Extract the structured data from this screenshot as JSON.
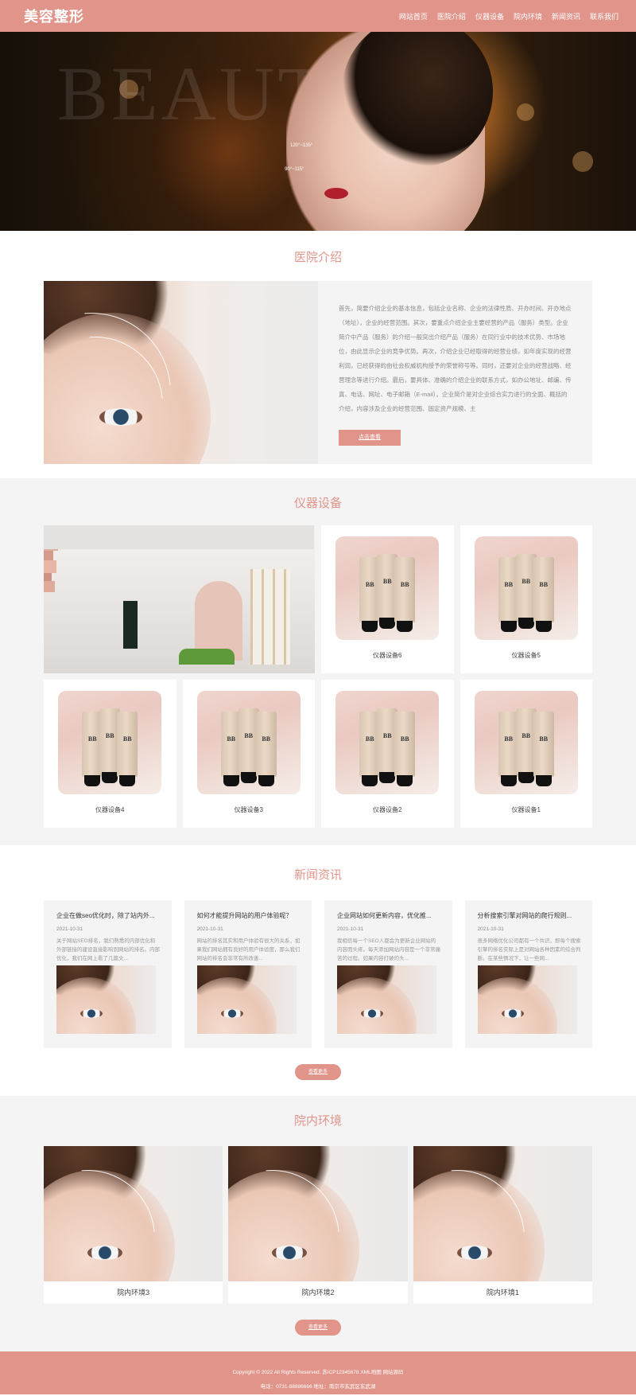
{
  "colors": {
    "accent": "#e0948a",
    "section_gray": "#f4f4f4"
  },
  "header": {
    "logo": "美容整形",
    "nav": [
      "网站首页",
      "医院介绍",
      "仪器设备",
      "院内环境",
      "新闻资讯",
      "联系我们"
    ]
  },
  "hero": {
    "word": "BEAUTY",
    "angle_top": "120°~135°",
    "angle_bottom": "90°~115°"
  },
  "intro": {
    "title": "医院介绍",
    "text": "首先，简要介绍企业的基本信息，包括企业名称、企业的法律性质、开办时间、开办地点（地址），企业的经营范围。其次，要重点介绍企业主要经营的产品（服务）类型。企业简介中产品（服务）的介绍一般突出介绍产品（服务）在同行业中的技术优势、市场地位，由此显示企业的竞争优势。再次，介绍企业已经取得的经营业绩，如年度实现的经营利润，已经获得的由社会权威机构授予的荣誉称号等。同时，还要对企业的经营战略、经营理念等进行介绍。最后，要具体、准确的介绍企业的联系方式，如办公地址、邮编、传真、电话、网址、电子邮箱（E-mail）。企业简介是对企业综合实力进行的全面、概括的介绍，内容涉及企业的经营范围、固定资产规模、主",
    "button": "点击查看"
  },
  "equipment": {
    "title": "仪器设备",
    "items": [
      "仪器设备6",
      "仪器设备5",
      "仪器设备4",
      "仪器设备3",
      "仪器设备2",
      "仪器设备1"
    ],
    "product_mark": "BB"
  },
  "news": {
    "title": "新闻资讯",
    "items": [
      {
        "title": "企业在做seo优化时，除了站内外...",
        "date": "2021-10-31",
        "desc": "关于网站SEO排名，我们熟悉的内部优化和外部链接的建设直接影响到网站的排名。内部优化，我们在网上看了几篇文..."
      },
      {
        "title": "如何才能提升网站的用户体验呢？",
        "date": "2021-10-31",
        "desc": "网站的排名其实和用户体验有很大的关系，如果我们网站拥有良好的用户体验度，那么我们网站的排名会非常有所改善..."
      },
      {
        "title": "企业网站如何更新内容，优化推...",
        "date": "2021-10-31",
        "desc": "我相信每一个SEO人都会为更新企业网站的内容而头疼。每天添加网站内容是一个非常痛苦的过程。如果内容打破的头..."
      },
      {
        "title": "分析搜索引擎对网站的爬行规则...",
        "date": "2021-10-31",
        "desc": "很多网络优化公司都有一个共识，即每个搜索引擎的排名实际上是对网站各种因素的综合判断。在某些情况下，让一些网..."
      }
    ],
    "more": "查看更多"
  },
  "environment": {
    "title": "院内环境",
    "items": [
      "院内环境3",
      "院内环境2",
      "院内环境1"
    ],
    "more": "查看更多"
  },
  "footer": {
    "line1": "Copyright © 2022 All Rights Reserved. 苏ICP12345678 XML地图 网站源码",
    "line2": "电话：0731-88886666 地址：南京市玄武区玄武湖"
  }
}
